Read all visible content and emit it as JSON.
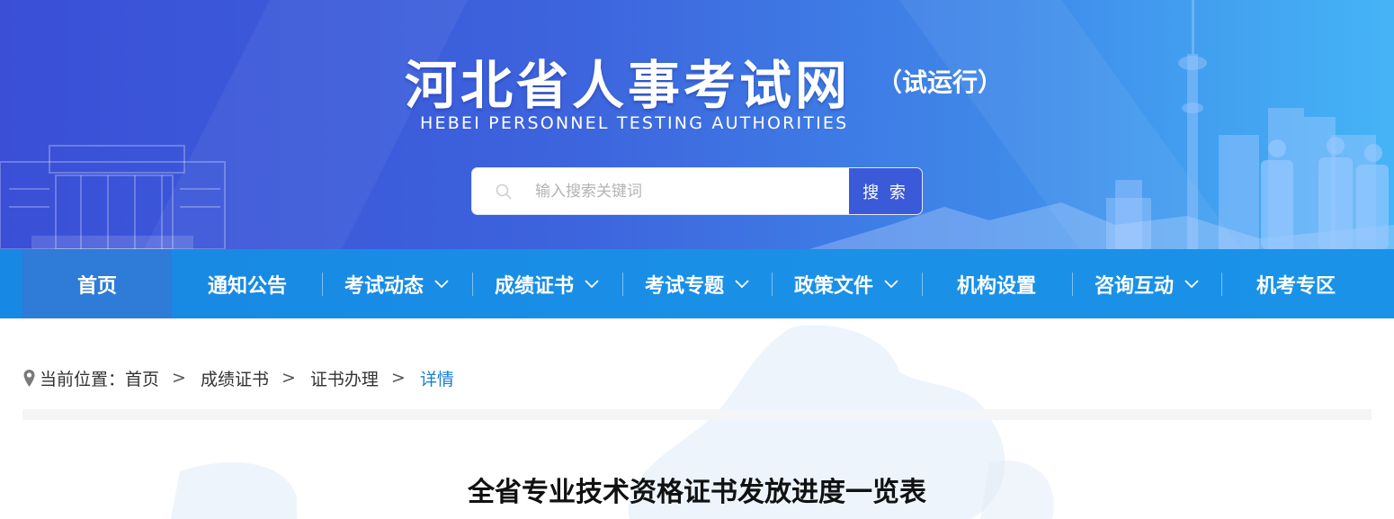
{
  "header": {
    "title": "河北省人事考试网",
    "trial_label": "（试运行）",
    "subtitle_en": "HEBEI  PERSONNEL  TESTING AUTHORITIES"
  },
  "search": {
    "placeholder": "输入搜索关键词",
    "value": "",
    "button_label": "搜 索",
    "icon": "search-icon"
  },
  "nav": {
    "items": [
      {
        "label": "首页",
        "active": true,
        "dropdown": false
      },
      {
        "label": "通知公告",
        "active": false,
        "dropdown": false
      },
      {
        "label": "考试动态",
        "active": false,
        "dropdown": true
      },
      {
        "label": "成绩证书",
        "active": false,
        "dropdown": true
      },
      {
        "label": "考试专题",
        "active": false,
        "dropdown": true
      },
      {
        "label": "政策文件",
        "active": false,
        "dropdown": true
      },
      {
        "label": "机构设置",
        "active": false,
        "dropdown": false
      },
      {
        "label": "咨询互动",
        "active": false,
        "dropdown": true
      },
      {
        "label": "机考专区",
        "active": false,
        "dropdown": false
      }
    ]
  },
  "breadcrumb": {
    "prefix": "当前位置：",
    "items": [
      "首页",
      "成绩证书",
      "证书办理"
    ],
    "current": "详情",
    "separator": ">"
  },
  "article": {
    "title": "全省专业技术资格证书发放进度一览表"
  },
  "colors": {
    "banner_start": "#3a4fd6",
    "banner_end": "#45b4f6",
    "nav_bg": "#1a8fe6",
    "nav_active": "#2e7bd8",
    "search_button": "#3a5ad9",
    "breadcrumb_current": "#1a7fd0"
  }
}
